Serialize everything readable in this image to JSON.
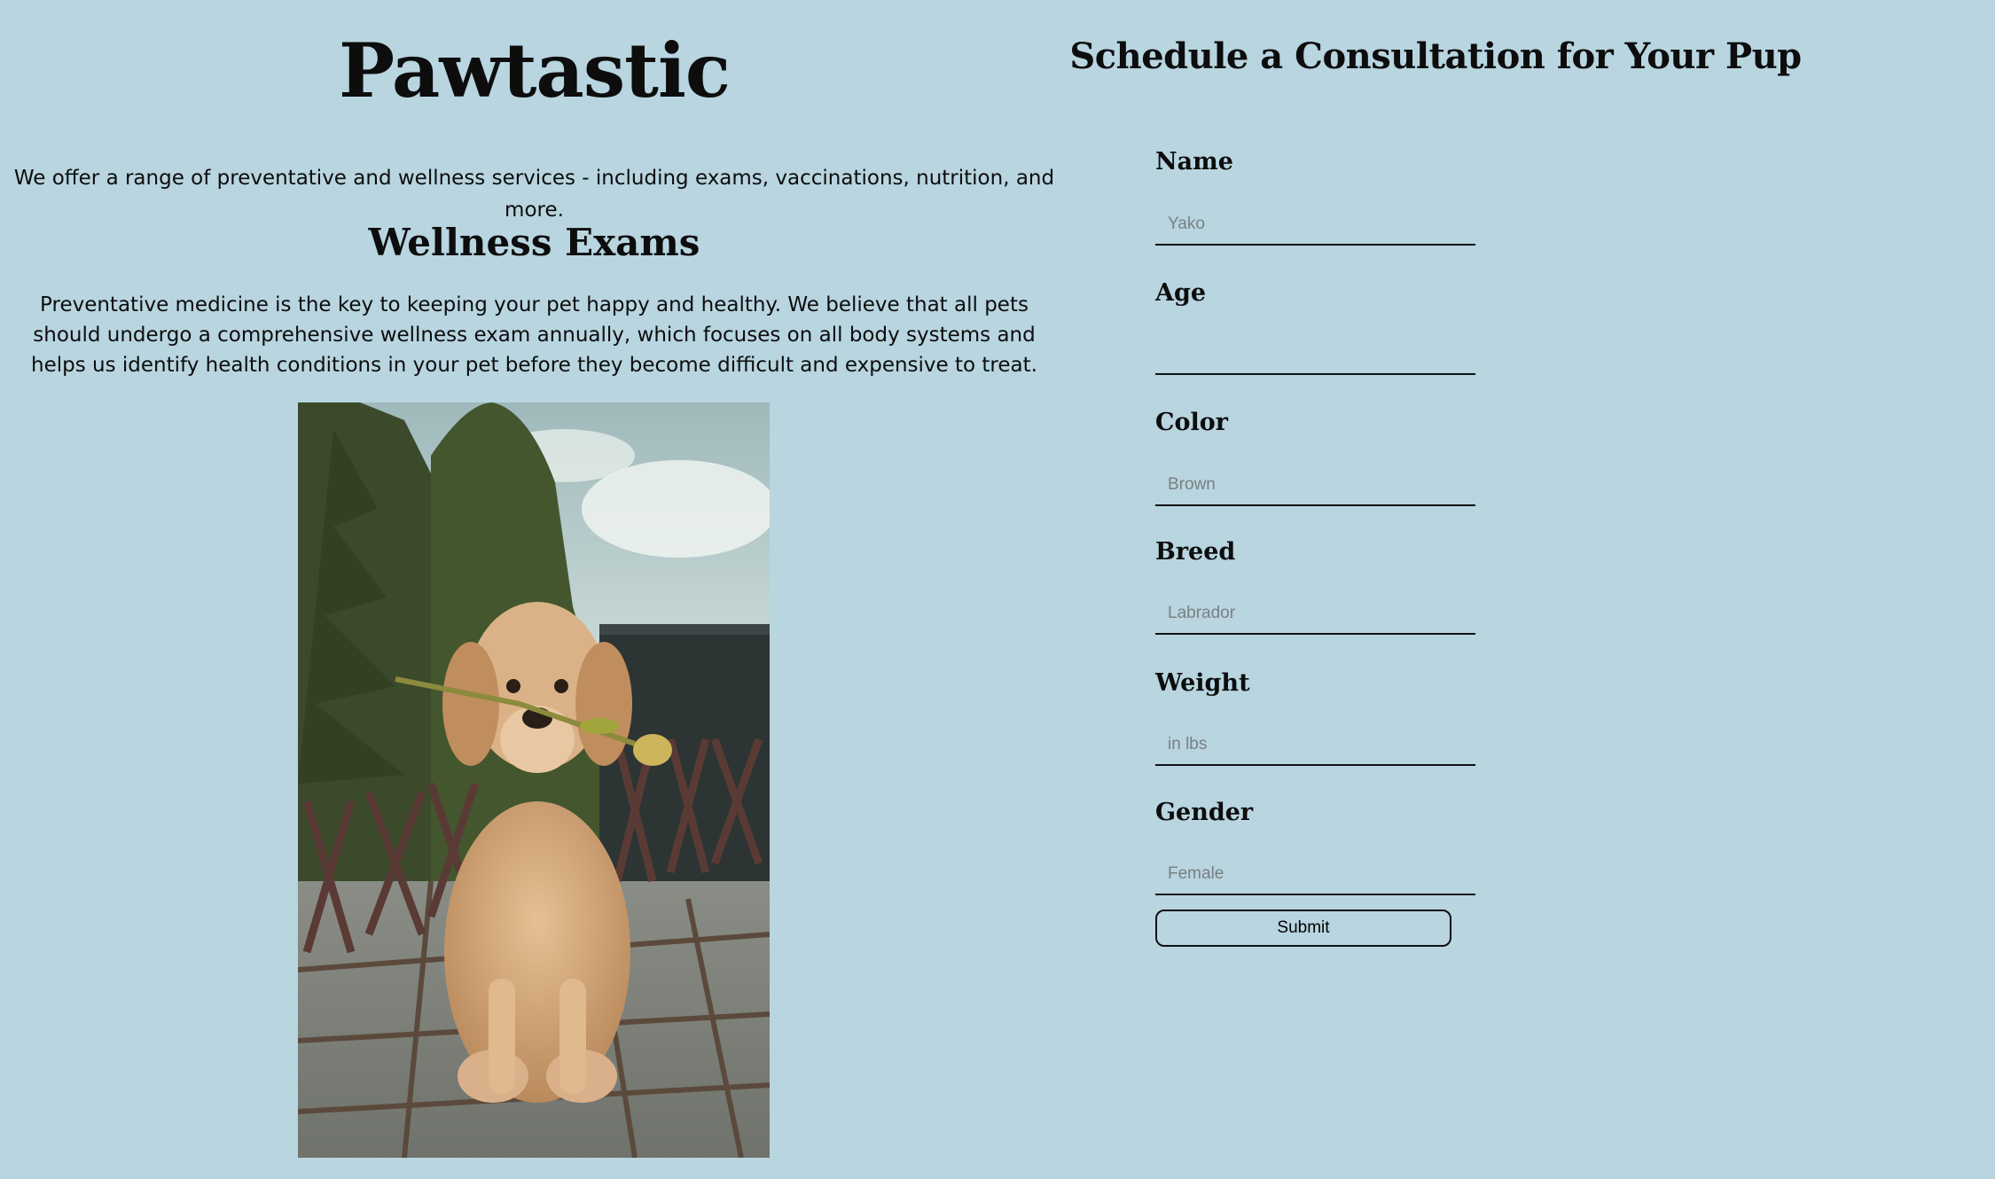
{
  "brand": {
    "title": "Pawtastic"
  },
  "intro": {
    "text": "We offer a range of preventative and wellness services - including exams, vaccinations, nutrition, and more."
  },
  "section": {
    "title": "Wellness Exams",
    "body": "Preventative medicine is the key to keeping your pet happy and healthy. We believe that all pets should undergo a comprehensive wellness exam annually, which focuses on all body systems and helps us identify health conditions in your pet before they become difficult and expensive to treat."
  },
  "form": {
    "title": "Schedule a Consultation for Your Pup",
    "fields": [
      {
        "label": "Name",
        "placeholder": "Yako",
        "value": ""
      },
      {
        "label": "Age",
        "placeholder": "",
        "value": ""
      },
      {
        "label": "Color",
        "placeholder": "Brown",
        "value": ""
      },
      {
        "label": "Breed",
        "placeholder": "Labrador",
        "value": ""
      },
      {
        "label": "Weight",
        "placeholder": "in lbs",
        "value": ""
      },
      {
        "label": "Gender",
        "placeholder": "Female",
        "value": ""
      }
    ],
    "submit_label": "Submit"
  },
  "colors": {
    "background": "#b8d5e0",
    "text": "#0d0d0d",
    "placeholder": "#7a7f82"
  }
}
